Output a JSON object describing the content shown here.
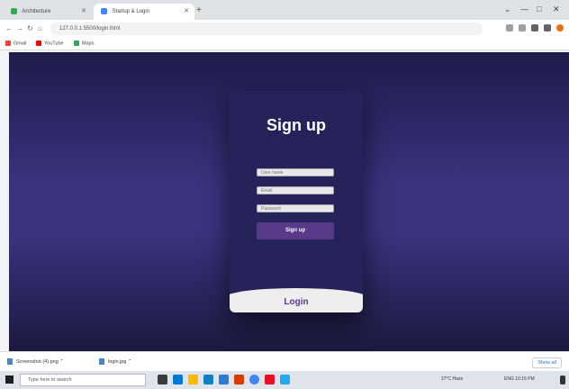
{
  "browser": {
    "tabs": [
      {
        "label": "Architecture",
        "color": "#34a853"
      },
      {
        "label": "Startup & Login",
        "color": "#4285f4"
      }
    ],
    "new_tab_symbol": "+",
    "window_controls": [
      "⌄",
      "—",
      "□",
      "✕"
    ],
    "address": "127.0.0.1:5500/login.html",
    "bookmarks": [
      {
        "label": "Gmail",
        "color": "#ea4335"
      },
      {
        "label": "YouTube",
        "color": "#ff0000"
      },
      {
        "label": "Maps",
        "color": "#34a853"
      }
    ]
  },
  "page": {
    "title": "Sign up",
    "username_placeholder": "User name",
    "email_placeholder": "Email",
    "password_placeholder": "Password",
    "signup_button": "Sign up",
    "login_label": "Login"
  },
  "downloads": {
    "items": [
      "Screenshot (4).png",
      "login.jpg"
    ],
    "show_all": "Show all"
  },
  "taskbar": {
    "search_placeholder": "Type here to search",
    "tray_weather": "27°C Haze",
    "tray_clock": "ENG 10:15 PM"
  }
}
